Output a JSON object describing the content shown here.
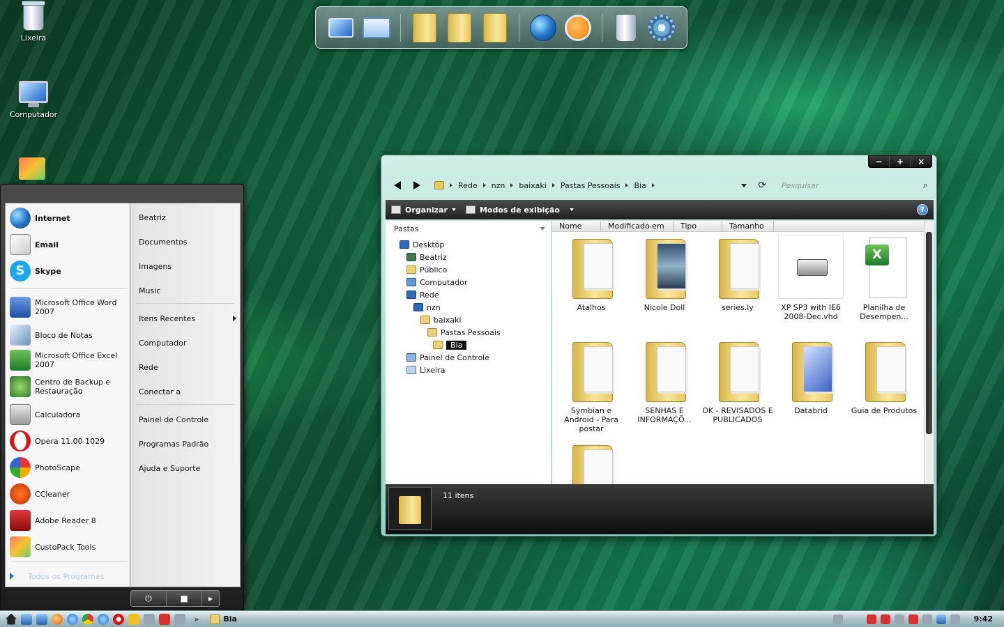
{
  "desktop": {
    "icons": [
      {
        "label": "Lixeira",
        "icon": "recycle-bin-icon"
      },
      {
        "label": "Computador",
        "icon": "computer-icon"
      }
    ]
  },
  "start_menu": {
    "pinned": [
      {
        "label": "Internet",
        "icon": "globe-icon"
      },
      {
        "label": "Email",
        "icon": "envelope-icon"
      },
      {
        "label": "Skype",
        "icon": "skype-icon"
      }
    ],
    "recent": [
      {
        "label": "Microsoft Office Word 2007",
        "icon": "word-icon"
      },
      {
        "label": "Bloco de Notas",
        "icon": "notepad-icon"
      },
      {
        "label": "Microsoft Office Excel 2007",
        "icon": "excel-icon"
      },
      {
        "label": "Centro de Backup e Restauração",
        "icon": "backup-icon"
      },
      {
        "label": "Calculadora",
        "icon": "calculator-icon"
      },
      {
        "label": "Opera 11.00 1029",
        "icon": "opera-icon"
      },
      {
        "label": "PhotoScape",
        "icon": "photoscape-icon"
      },
      {
        "label": "CCleaner",
        "icon": "ccleaner-icon"
      },
      {
        "label": "Adobe Reader 8",
        "icon": "adobe-reader-icon"
      },
      {
        "label": "CustoPack Tools",
        "icon": "custopack-icon"
      }
    ],
    "all_programs": "Todos os Programas",
    "right": [
      {
        "label": "Beatriz"
      },
      {
        "label": "Documentos"
      },
      {
        "label": "Imagens"
      },
      {
        "label": "Music"
      },
      {
        "label": "Itens Recentes"
      },
      {
        "label": "Computador"
      },
      {
        "label": "Rede"
      },
      {
        "label": "Conectar a"
      },
      {
        "label": "Painel de Controle"
      },
      {
        "label": "Programas Padrão"
      },
      {
        "label": "Ajuda e Suporte"
      }
    ]
  },
  "explorer": {
    "breadcrumb": [
      "Rede",
      "nzn",
      "baixaki",
      "Pastas Pessoais",
      "Bia"
    ],
    "search_placeholder": "Pesquisar",
    "toolbar": {
      "organize": "Organizar",
      "views": "Modos de exibição"
    },
    "nav_header": "Pastas",
    "tree": [
      {
        "label": "Desktop",
        "icon": "desktop"
      },
      {
        "label": "Beatriz",
        "icon": "user"
      },
      {
        "label": "Público",
        "icon": "folder"
      },
      {
        "label": "Computador",
        "icon": "computer"
      },
      {
        "label": "Rede",
        "icon": "network"
      },
      {
        "label": "nzn",
        "icon": "network"
      },
      {
        "label": "baixaki",
        "icon": "folder"
      },
      {
        "label": "Pastas Pessoais",
        "icon": "folder"
      },
      {
        "label": "Bia",
        "icon": "folder"
      },
      {
        "label": "Painel de Controle",
        "icon": "control-panel"
      },
      {
        "label": "Lixeira",
        "icon": "recycle-bin"
      }
    ],
    "columns": [
      "Nome",
      "Modificado em",
      "Tipo",
      "Tamanho"
    ],
    "files": [
      {
        "name": "Atalhos",
        "kind": "folder"
      },
      {
        "name": "Nicole Doll",
        "kind": "folder-photo"
      },
      {
        "name": "series.ly",
        "kind": "folder"
      },
      {
        "name": "XP SP3 with IE6 2008-Dec.vhd",
        "kind": "drive"
      },
      {
        "name": "Planilha de Desempen...",
        "kind": "excel"
      },
      {
        "name": "Symbian e Android - Para postar",
        "kind": "folder"
      },
      {
        "name": "SENHAS E INFORMAÇÕ...",
        "kind": "folder"
      },
      {
        "name": "OK - REVISADOS E PUBLICADOS",
        "kind": "folder"
      },
      {
        "name": "Databrid",
        "kind": "folder-blue"
      },
      {
        "name": "Guia de Produtos",
        "kind": "folder"
      },
      {
        "name": "",
        "kind": "folder"
      }
    ],
    "status": "11 itens"
  },
  "taskbar": {
    "task": "Bia",
    "more": "»",
    "clock": "9:42"
  }
}
